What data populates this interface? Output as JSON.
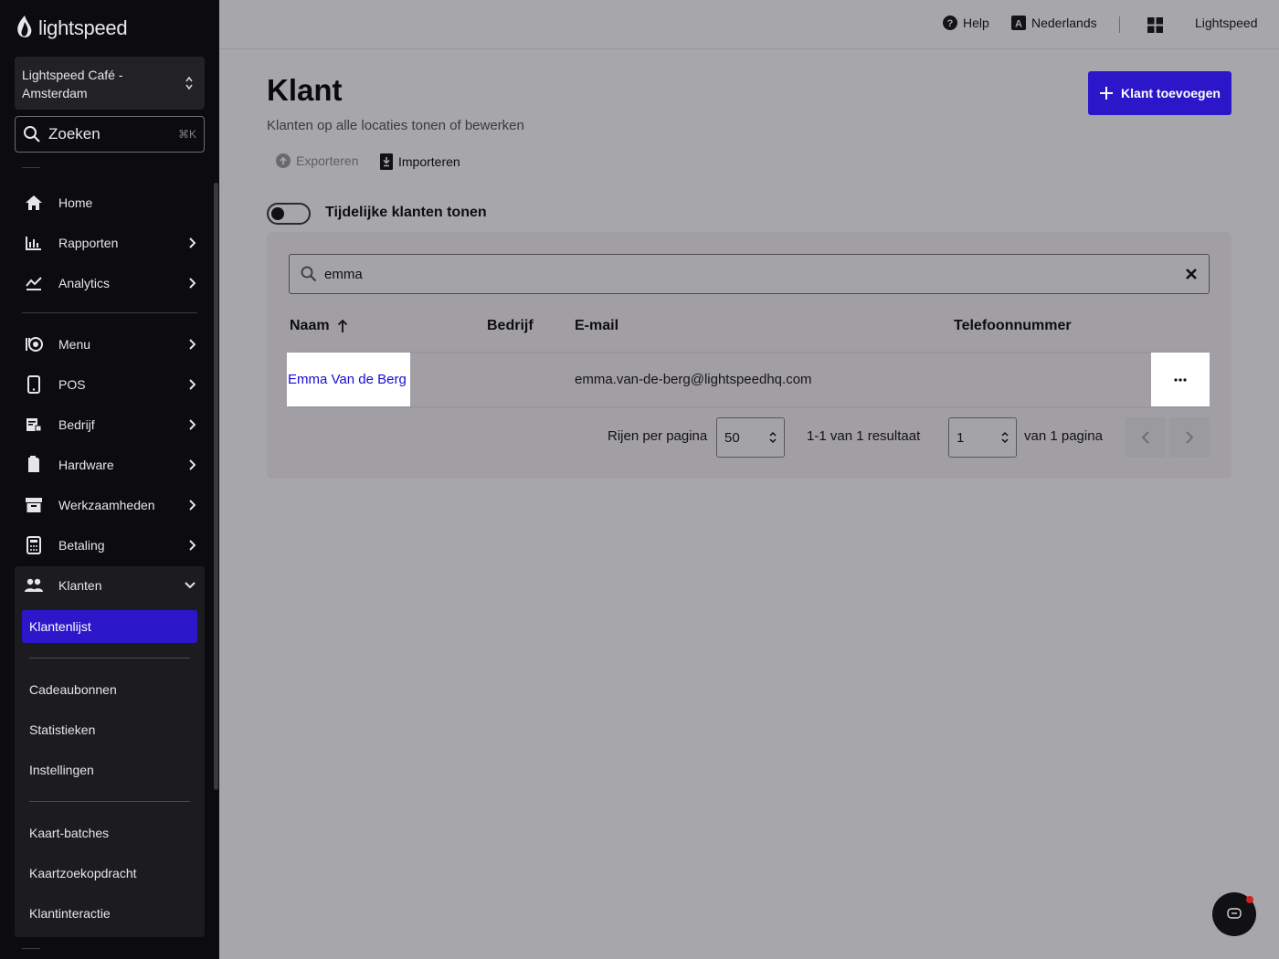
{
  "sidebar": {
    "logo": "lightspeed",
    "venue": "Lightspeed Café - Amsterdam",
    "search": {
      "label": "Zoeken",
      "shortcut": "⌘K"
    },
    "nav": [
      {
        "label": "Home",
        "icon": "home-icon"
      },
      {
        "label": "Rapporten",
        "icon": "bar-chart-icon"
      },
      {
        "label": "Analytics",
        "icon": "analytics-icon"
      },
      {
        "label": "Menu",
        "icon": "menu-icon"
      },
      {
        "label": "POS",
        "icon": "tablet-icon"
      },
      {
        "label": "Bedrijf",
        "icon": "business-icon"
      },
      {
        "label": "Hardware",
        "icon": "hardware-icon"
      },
      {
        "label": "Werkzaamheden",
        "icon": "archive-icon"
      },
      {
        "label": "Betaling",
        "icon": "calculator-icon"
      },
      {
        "label": "Klanten",
        "icon": "users-icon"
      }
    ],
    "klanten_sub": {
      "active": "Klantenlijst",
      "items": [
        "Cadeaubonnen",
        "Statistieken",
        "Instellingen"
      ],
      "items2": [
        "Kaart-batches",
        "Kaartzoekopdracht",
        "Klantinteractie"
      ]
    }
  },
  "topbar": {
    "help": "Help",
    "language": "Nederlands",
    "account": "Lightspeed"
  },
  "page": {
    "title": "Klant",
    "subtitle": "Klanten op alle locaties tonen of bewerken",
    "add_button": "Klant toevoegen",
    "export": "Exporteren",
    "import": "Importeren",
    "toggle_label": "Tijdelijke klanten tonen",
    "toggle_on": false
  },
  "table": {
    "search_value": "emma",
    "columns": [
      "Naam",
      "Bedrijf",
      "E-mail",
      "Telefoonnummer"
    ],
    "rows": [
      {
        "name": "Emma Van de Berg",
        "company": "",
        "email": "emma.van-de-berg@lightspeedhq.com",
        "phone": ""
      }
    ]
  },
  "pagination": {
    "rows_label": "Rijen per pagina",
    "rows_value": "50",
    "result_text": "1-1 van 1 resultaat",
    "page_value": "1",
    "page_total_text": "van 1 pagina"
  },
  "colors": {
    "accent": "#2b17c9",
    "link": "#1a0dd1",
    "sidebar_bg": "#0c0c0e"
  }
}
